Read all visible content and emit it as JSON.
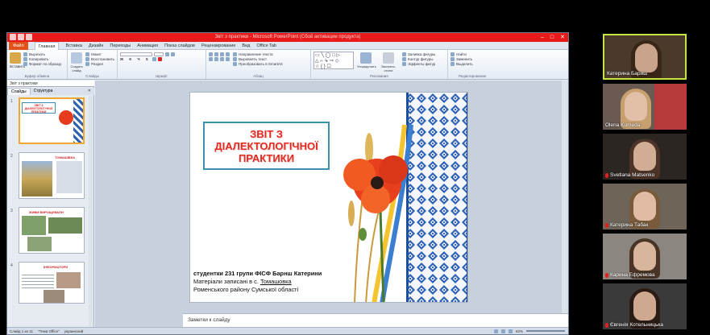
{
  "ppt": {
    "title": "Звіт з практики - Microsoft PowerPoint (Сбой активации продукта)",
    "tabs": [
      "Файл",
      "Главная",
      "Вставка",
      "Дизайн",
      "Переходы",
      "Анимация",
      "Показ слайдов",
      "Рецензирование",
      "Вид",
      "Office Tab"
    ],
    "ribbon_groups": {
      "clipboard": {
        "name": "Буфер обмена",
        "paste": "Вставить",
        "cut": "Вырезать",
        "copy": "Копировать",
        "format": "Формат по образцу"
      },
      "slides": {
        "name": "Слайды",
        "new": "Создать слайд",
        "layout": "Макет",
        "reset": "Восстановить",
        "section": "Раздел"
      },
      "font": {
        "name": "Шрифт"
      },
      "paragraph": {
        "name": "Абзац",
        "dir": "Направление текста",
        "align": "Выровнять текст",
        "smart": "Преобразовать в SmartArt"
      },
      "drawing": {
        "name": "Рисование",
        "arrange": "Упорядочить",
        "styles": "Экспресс-стили",
        "fill": "Заливка фигуры",
        "outline": "Контур фигуры",
        "effects": "Эффекты фигур"
      },
      "editing": {
        "name": "Редактирование",
        "find": "Найти",
        "replace": "Заменить",
        "select": "Выделить"
      }
    },
    "doc_tab": "Звіт з практики",
    "pane_tabs": {
      "slides": "Слайды",
      "outline": "Структура"
    },
    "thumbs": [
      {
        "num": "1",
        "title": "ЗВІТ З ДІАЛЕКТОЛОГІЧНОЇ ПРАКТИКИ"
      },
      {
        "num": "2",
        "title": "ТОМАШІВКА"
      },
      {
        "num": "3",
        "title": "ЖИВИ ВИРОЩУВАЛИ"
      },
      {
        "num": "4",
        "title": "ІНФОРМАТОРИ"
      }
    ],
    "slide": {
      "title": "ЗВІТ З ДІАЛЕКТОЛОГІЧНОЇ ПРАКТИКИ",
      "line1": "студентки 231 групи ФІСФ Барнш Катерини",
      "line2_prefix": "Матеріали записані в с. ",
      "line2_place": "Томашовка",
      "line3": "Роменського району Сумської області"
    },
    "notes_placeholder": "Заметки к слайду",
    "status": {
      "slide": "Слайд 1 из 11",
      "theme": "\"Тема Office\"",
      "lang": "украинский",
      "zoom": "62%"
    }
  },
  "participants": [
    {
      "name": "Катерина Бариш",
      "muted": false,
      "active": true
    },
    {
      "name": "Olena Kumeda",
      "muted": false,
      "active": false
    },
    {
      "name": "Svetlana Matsenko",
      "muted": true,
      "active": false
    },
    {
      "name": "Катерина Табак",
      "muted": true,
      "active": false
    },
    {
      "name": "Карина Ефремова",
      "muted": true,
      "active": false
    },
    {
      "name": "Євгенія Котельницька",
      "muted": true,
      "active": false
    }
  ],
  "colors": {
    "title_red": "#e02b23",
    "title_border": "#3d8fae",
    "ppt_title_bar": "#e81a1a",
    "active_speaker": "#c5e640"
  }
}
